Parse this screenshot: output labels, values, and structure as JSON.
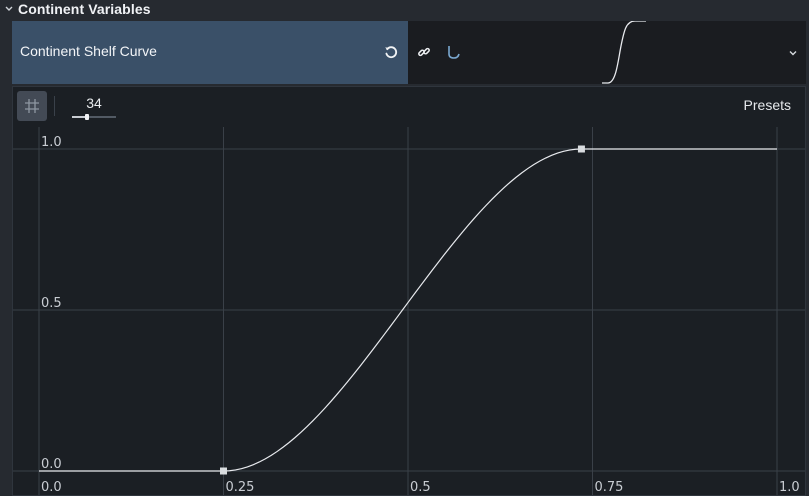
{
  "section": {
    "title": "Continent Variables"
  },
  "property": {
    "name": "Continent Shelf Curve"
  },
  "editor": {
    "snap_value": "34",
    "snap_fraction": 0.34,
    "presets_label": "Presets",
    "x_ticks": [
      "0.0",
      "0.25",
      "0.5",
      "0.75",
      "1.0"
    ],
    "y_ticks": [
      "0.0",
      "0.5",
      "1.0"
    ]
  },
  "chart_data": {
    "type": "line",
    "xlim": [
      0,
      1
    ],
    "ylim": [
      0,
      1
    ],
    "grid": true,
    "x_ticks": [
      0,
      0.25,
      0.5,
      0.75,
      1.0
    ],
    "y_ticks": [
      0,
      0.5,
      1.0
    ],
    "control_points": [
      {
        "x": 0.0,
        "y": 0.0
      },
      {
        "x": 0.25,
        "y": 0.0
      },
      {
        "x": 0.735,
        "y": 1.0
      },
      {
        "x": 1.0,
        "y": 1.0
      }
    ],
    "handles": [
      {
        "x": 0.25,
        "y": 0.0
      },
      {
        "x": 0.735,
        "y": 1.0
      }
    ]
  },
  "colors": {
    "header_bg": "#3a5068",
    "curve": "#e8eaee",
    "grid": "#3a4048"
  }
}
